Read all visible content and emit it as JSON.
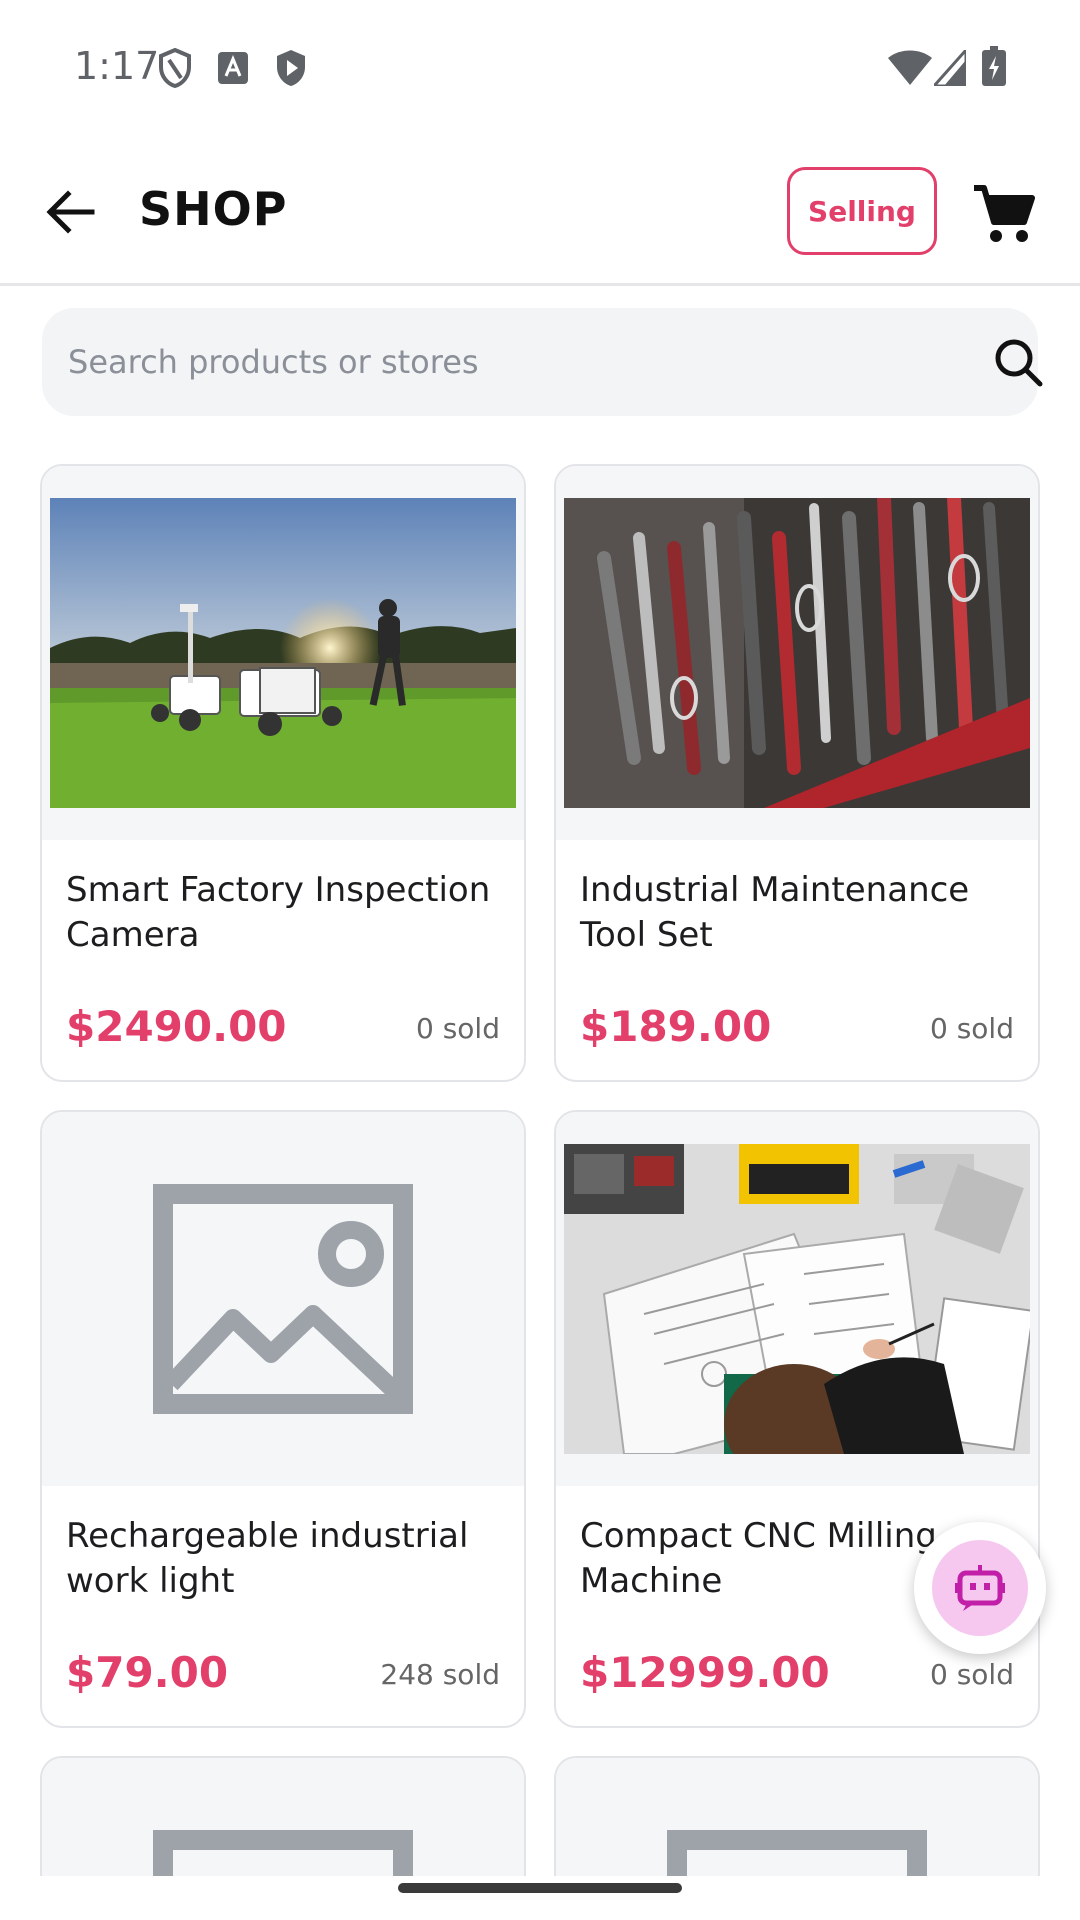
{
  "status_bar": {
    "time": "1:17",
    "left_icons": [
      "vpn-key-icon",
      "keyboard-a-icon",
      "shield-play-icon"
    ],
    "right_icons": [
      "wifi-icon",
      "cellular-signal-icon",
      "battery-charging-icon"
    ]
  },
  "header": {
    "title": "SHOP",
    "back_icon": "arrow-back-icon",
    "selling_label": "Selling",
    "cart_icon": "shopping-cart-icon"
  },
  "search": {
    "placeholder": "Search products or stores",
    "value": "",
    "icon": "search-icon"
  },
  "products": [
    {
      "name": "Smart Factory Inspection Camera",
      "price": "$2490.00",
      "sold": "0 sold",
      "image": "field-robot-photo"
    },
    {
      "name": "Industrial Maintenance Tool Set",
      "price": "$189.00",
      "sold": "0 sold",
      "image": "pliers-rack-photo"
    },
    {
      "name": "Rechargeable industrial work light",
      "price": "$79.00",
      "sold": "248 sold",
      "image": "placeholder-image-icon"
    },
    {
      "name": "Compact CNC Milling Machine",
      "price": "$12999.00",
      "sold": "0 sold",
      "image": "engineer-drafting-photo"
    }
  ],
  "fab": {
    "icon": "robot-assistant-icon"
  },
  "colors": {
    "accent": "#e23f6b",
    "placeholder_gray": "#9ea3aa",
    "search_bg": "#f3f4f6",
    "fab_bg": "#f6c8ef",
    "fab_icon": "#c21fa8"
  }
}
